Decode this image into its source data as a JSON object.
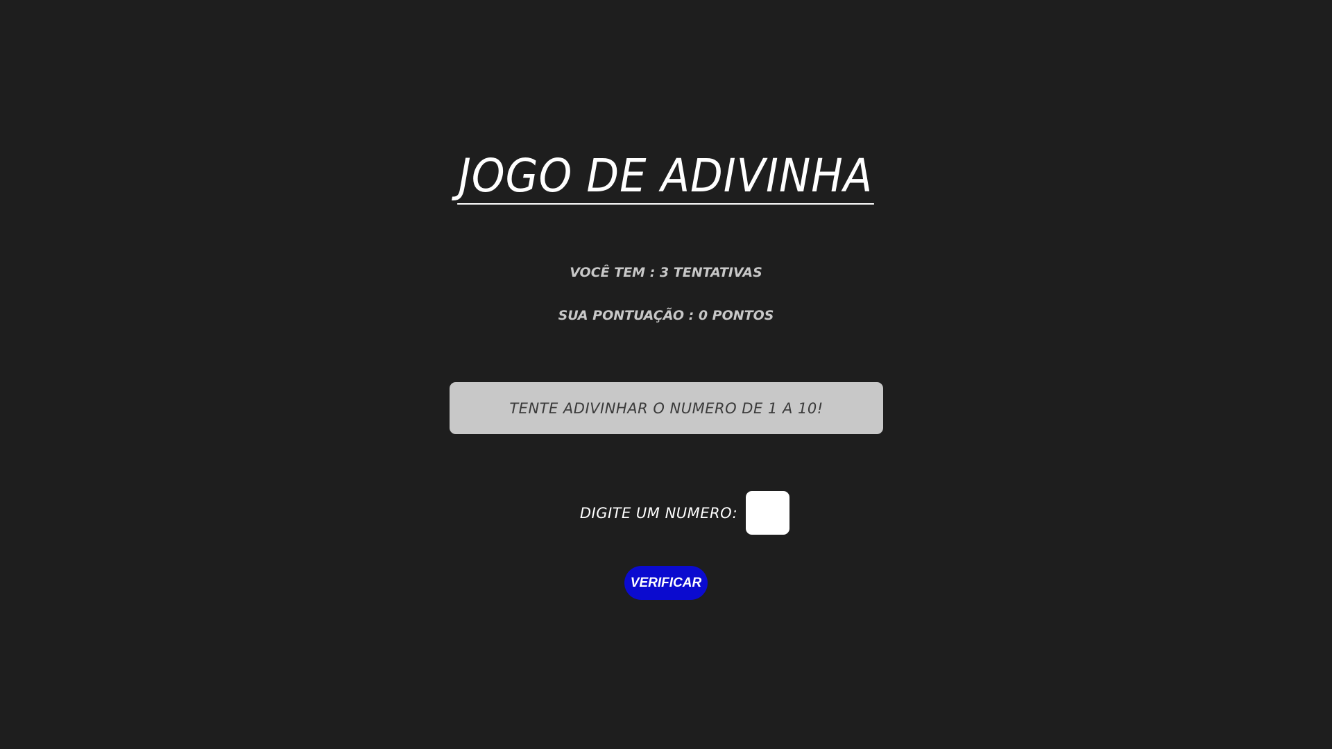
{
  "title": "JOGO DE ADIVINHA",
  "status": {
    "attempts_text": "VOCÊ TEM : 3 TENTATIVAS",
    "score_text": "SUA PONTUAÇÃO : 0 PONTOS"
  },
  "message": "TENTE ADIVINHAR O NUMERO DE 1 A 10!",
  "guess": {
    "label": "DIGITE UM NUMERO:",
    "value": ""
  },
  "verify_button": "VERIFICAR",
  "colors": {
    "background": "#1e1e1e",
    "message_box": "#c8c8c8",
    "button": "#0b0bcf"
  }
}
